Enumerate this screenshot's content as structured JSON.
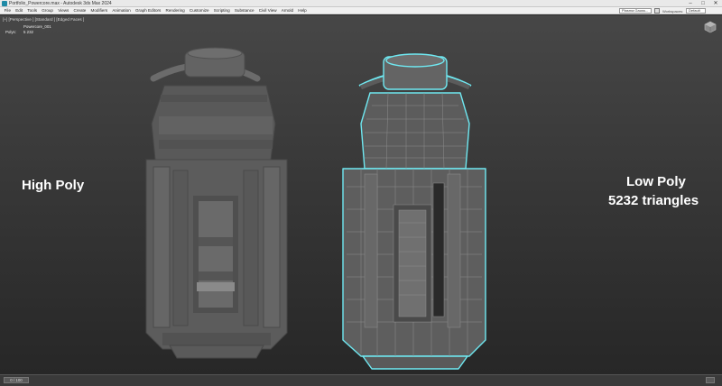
{
  "window": {
    "title": "Portfolio_Powercore.max - Autodesk 3ds Max 2024",
    "controls": {
      "minimize": "–",
      "maximize": "□",
      "close": "✕"
    }
  },
  "menubar": {
    "items": [
      "File",
      "Edit",
      "Tools",
      "Group",
      "Views",
      "Create",
      "Modifiers",
      "Animation",
      "Graph Editors",
      "Rendering",
      "Customize",
      "Scripting",
      "Substance",
      "Civil View",
      "Arnold",
      "Help"
    ],
    "search_value": "Plasma Gauss...",
    "workspaces_label": "Workspaces:",
    "workspaces_value": "Default"
  },
  "viewport": {
    "label": "[+] [Perspective ] [Standard ] [Edged Faces ]",
    "stats": {
      "object_name": "Powercore_001",
      "polys_label": "Polys:",
      "polys_value": "5 232"
    }
  },
  "captions": {
    "high_poly": "High Poly",
    "low_poly_line1": "Low Poly",
    "low_poly_line2": "5232 triangles"
  },
  "timeline": {
    "counter": "0 / 100"
  },
  "colors": {
    "selection_outline": "#6fe9f2",
    "high_poly_fill": "#5d5d5d",
    "low_poly_fill": "#616161"
  }
}
